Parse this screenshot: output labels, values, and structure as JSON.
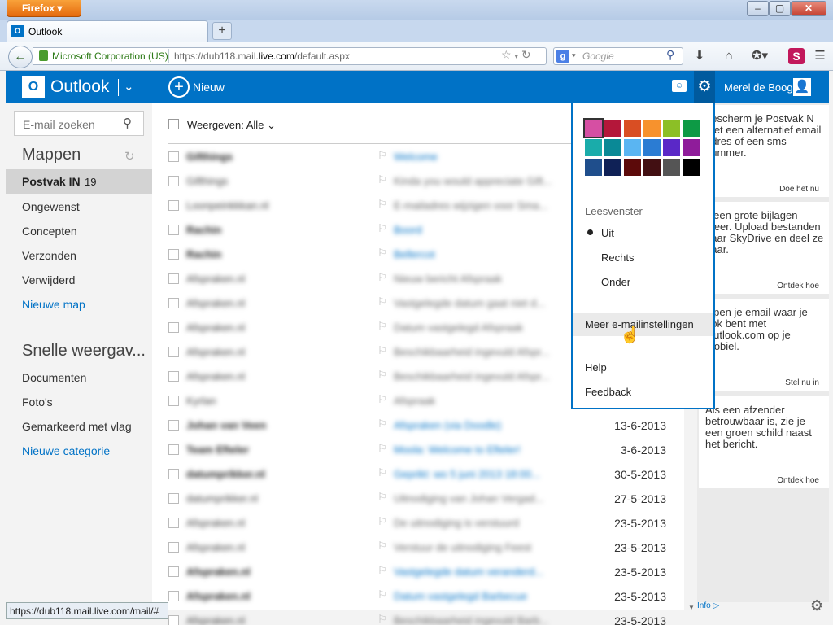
{
  "browser": {
    "app_button": "Firefox",
    "tab_title": "Outlook",
    "tab_icon": "O",
    "identity": "Microsoft Corporation (US)",
    "url_prefix": "https://dub118.mail.",
    "url_domain": "live.com",
    "url_suffix": "/default.aspx",
    "search_placeholder": "Google",
    "status_url": "https://dub118.mail.live.com/mail/#"
  },
  "header": {
    "logo_letter": "O",
    "app_name": "Outlook",
    "new_label": "Nieuw",
    "user_name": "Merel de Boog"
  },
  "sidebar": {
    "search_placeholder": "E-mail zoeken",
    "folders_title": "Mappen",
    "inbox_label": "Postvak IN",
    "inbox_count": "19",
    "folders": [
      "Ongewenst",
      "Concepten",
      "Verzonden",
      "Verwijderd"
    ],
    "new_folder": "Nieuwe map",
    "quick_views_title": "Snelle weergav...",
    "quick_views": [
      "Documenten",
      "Foto's",
      "Gemarkeerd met vlag"
    ],
    "new_category": "Nieuwe categorie"
  },
  "list": {
    "view_label": "Weergeven: Alle",
    "rows": [
      {
        "from": "Gifthings",
        "subject": "Welcome",
        "date": "",
        "unread": true
      },
      {
        "from": "Gifthings",
        "subject": "Kinda you would appreciate Gift...",
        "date": "",
        "unread": false
      },
      {
        "from": "Loonpeinkkkan.nl",
        "subject": "E-mailadres wijzigen voor Sma...",
        "date": "",
        "unread": false
      },
      {
        "from": "Rachin",
        "subject": "Boord",
        "date": "",
        "unread": true
      },
      {
        "from": "Rachin",
        "subject": "Bellercot",
        "date": "",
        "unread": true
      },
      {
        "from": "Afspraken.nl",
        "subject": "Nieuw bericht Afspraak",
        "date": "",
        "unread": false
      },
      {
        "from": "Afspraken.nl",
        "subject": "Vastgelegde datum gaat niet d...",
        "date": "",
        "unread": false
      },
      {
        "from": "Afspraken.nl",
        "subject": "Datum vastgelegd Afspraak",
        "date": "",
        "unread": false
      },
      {
        "from": "Afspraken.nl",
        "subject": "Beschikbaarheid ingevuld Afspr...",
        "date": "",
        "unread": false
      },
      {
        "from": "Afspraken.nl",
        "subject": "Beschikbaarheid ingevuld Afspr...",
        "date": "",
        "unread": false
      },
      {
        "from": "Kyrlan",
        "subject": "Afspraak",
        "date": "",
        "unread": false
      },
      {
        "from": "Johan van Veen",
        "subject": "Afspraken (via Doodle)",
        "date": "13-6-2013",
        "unread": true
      },
      {
        "from": "Team Efteler",
        "subject": "Moola: Welcome to Efteler!",
        "date": "3-6-2013",
        "unread": true
      },
      {
        "from": "datumprikker.nl",
        "subject": "Geprikt: wo 5 juni 2013 18:00...",
        "date": "30-5-2013",
        "unread": true
      },
      {
        "from": "datumprikker.nl",
        "subject": "Uitnodiging van Johan Vergad...",
        "date": "27-5-2013",
        "unread": false
      },
      {
        "from": "Afspraken.nl",
        "subject": "De uitnodiging is verstuurd",
        "date": "23-5-2013",
        "unread": false
      },
      {
        "from": "Afspraken.nl",
        "subject": "Verstuur de uitnodiging Feest",
        "date": "23-5-2013",
        "unread": false
      },
      {
        "from": "Afspraken.nl",
        "subject": "Vastgelegde datum veranderd...",
        "date": "23-5-2013",
        "unread": true
      },
      {
        "from": "Afspraken.nl",
        "subject": "Datum vastgelegd Barbecue",
        "date": "23-5-2013",
        "unread": true
      },
      {
        "from": "Afspraken.nl",
        "subject": "Beschikbaarheid ingevuld Barb...",
        "date": "23-5-2013",
        "unread": false
      }
    ]
  },
  "settings_menu": {
    "theme_colors": [
      "#d64fa3",
      "#b4173a",
      "#d94e23",
      "#f7922d",
      "#8cbf26",
      "#0d9a45",
      "#1aacaa",
      "#0a8996",
      "#5ab5f2",
      "#2b7cd3",
      "#5a28c7",
      "#8f1c9a",
      "#1f4e8c",
      "#0f2156",
      "#5c0a0a",
      "#420f12",
      "#555555",
      "#000000"
    ],
    "reading_pane_label": "Leesvenster",
    "reading_pane_options": [
      "Uit",
      "Rechts",
      "Onder"
    ],
    "reading_pane_selected": "Uit",
    "more_settings": "Meer e-mailinstellingen",
    "help": "Help",
    "feedback": "Feedback"
  },
  "ads": [
    {
      "text": "bescherm je Postvak N met een alternatief email adres of een sms nummer.",
      "link": "Doe het nu"
    },
    {
      "text": "Geen grote bijlagen meer. Upload bestanden naar SkyDrive en deel ze daar.",
      "link": "Ontdek hoe"
    },
    {
      "text": "Open je email waar je ook bent met Outlook.com op je mobiel.",
      "link": "Stel nu in"
    },
    {
      "text": "Als een afzender betrouwbaar is, zie je een groen schild naast het bericht.",
      "link": "Ontdek hoe"
    }
  ],
  "ads_info": "Info"
}
